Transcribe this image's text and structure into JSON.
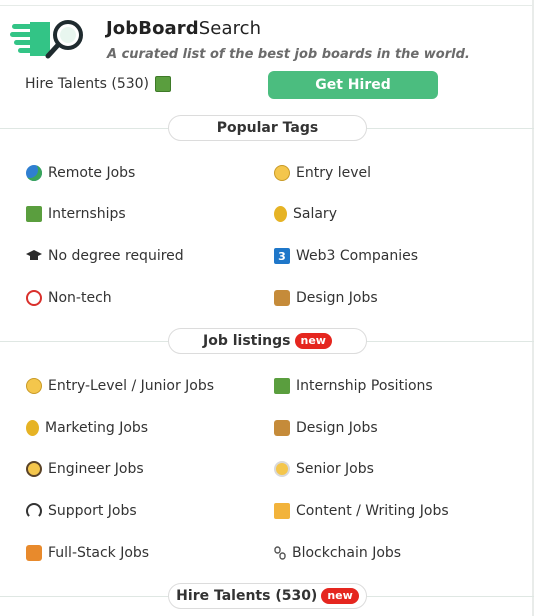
{
  "brand": {
    "name_bold": "JobBoard",
    "name_light": "Search",
    "tagline": "A curated list of the best job boards in the world."
  },
  "header": {
    "hire_label": "Hire Talents (530)",
    "cta_label": "Get Hired"
  },
  "popular_tags": {
    "title": "Popular Tags",
    "left": [
      {
        "label": "Remote Jobs",
        "icon": "globe-icon"
      },
      {
        "label": "Internships",
        "icon": "student-icon"
      },
      {
        "label": "No degree required",
        "icon": "graduation-cap-icon"
      },
      {
        "label": "Non-tech",
        "icon": "no-sign-icon"
      }
    ],
    "right": [
      {
        "label": "Entry level",
        "icon": "baby-face-icon"
      },
      {
        "label": "Salary",
        "icon": "money-bag-icon"
      },
      {
        "label": "Web3 Companies",
        "icon": "number-three-icon",
        "icon_text": "3"
      },
      {
        "label": "Design Jobs",
        "icon": "artist-icon"
      }
    ]
  },
  "job_listings": {
    "title": "Job listings",
    "badge": "new",
    "left": [
      {
        "label": "Entry-Level / Junior Jobs",
        "icon": "baby-face-icon"
      },
      {
        "label": "Marketing Jobs",
        "icon": "money-bag-icon"
      },
      {
        "label": "Engineer Jobs",
        "icon": "nerd-face-icon"
      },
      {
        "label": "Support Jobs",
        "icon": "headphones-icon"
      },
      {
        "label": "Full-Stack Jobs",
        "icon": "stack-icon"
      }
    ],
    "right": [
      {
        "label": "Internship Positions",
        "icon": "student-icon"
      },
      {
        "label": "Design Jobs",
        "icon": "artist-icon"
      },
      {
        "label": "Senior Jobs",
        "icon": "older-person-icon"
      },
      {
        "label": "Content / Writing Jobs",
        "icon": "writing-hand-icon"
      },
      {
        "label": "Blockchain Jobs",
        "icon": "chain-icon"
      }
    ]
  },
  "footer_section": {
    "title": "Hire Talents (530)",
    "badge": "new"
  },
  "colors": {
    "accent_green": "#4bbd7f",
    "badge_red": "#e5261f"
  }
}
